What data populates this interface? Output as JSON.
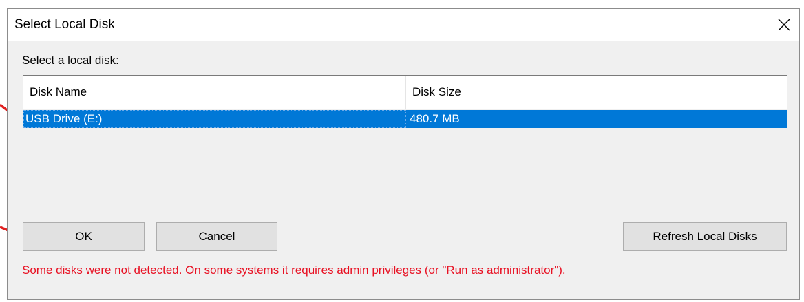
{
  "dialog": {
    "title": "Select Local Disk",
    "close_icon": "close-icon",
    "prompt": "Select a local disk:",
    "columns": [
      "Disk Name",
      "Disk Size"
    ],
    "rows": [
      {
        "name": "USB Drive (E:)",
        "size": "480.7 MB",
        "selected": true
      }
    ],
    "buttons": {
      "ok": "OK",
      "cancel": "Cancel",
      "refresh": "Refresh Local Disks"
    },
    "warning": "Some disks were not detected. On some systems it requires admin privileges (or \"Run as administrator\")."
  },
  "colors": {
    "selection": "#0078d7",
    "warning": "#e81123",
    "annotation_arrow": "#e0201f"
  }
}
